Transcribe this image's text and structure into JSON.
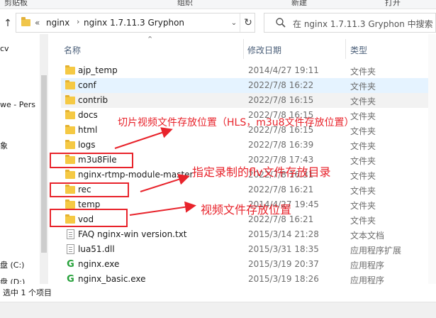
{
  "ribbon": {
    "labels": [
      "剪贴板",
      "组织",
      "新建",
      "打开"
    ]
  },
  "address": {
    "overflow": "«",
    "crumbs": [
      "nginx",
      "nginx 1.7.11.3 Gryphon"
    ]
  },
  "search": {
    "placeholder": "在 nginx 1.7.11.3 Gryphon 中搜索"
  },
  "nav_pane": {
    "items": [
      "cv",
      "we - Pers",
      "象",
      "盘 (C:)",
      "盘 (D:)"
    ]
  },
  "columns": {
    "name": "名称",
    "date": "修改日期",
    "type": "类型"
  },
  "files": [
    {
      "name": "ajp_temp",
      "date": "2014/4/27 19:11",
      "type": "文件夹",
      "icon": "folder-icon"
    },
    {
      "name": "conf",
      "date": "2022/7/8 16:22",
      "type": "文件夹",
      "icon": "folder-icon"
    },
    {
      "name": "contrib",
      "date": "2022/7/8 16:15",
      "type": "文件夹",
      "icon": "folder-icon"
    },
    {
      "name": "docs",
      "date": "2022/7/8 16:15",
      "type": "文件夹",
      "icon": "folder-icon"
    },
    {
      "name": "html",
      "date": "2022/7/8 16:15",
      "type": "文件夹",
      "icon": "folder-icon"
    },
    {
      "name": "logs",
      "date": "2022/7/8 16:39",
      "type": "文件夹",
      "icon": "folder-icon"
    },
    {
      "name": "m3u8File",
      "date": "2022/7/8 17:43",
      "type": "文件夹",
      "icon": "folder-icon"
    },
    {
      "name": "nginx-rtmp-module-master",
      "date": "2022/7/8 16:31",
      "type": "文件夹",
      "icon": "folder-icon"
    },
    {
      "name": "rec",
      "date": "2022/7/8 16:21",
      "type": "文件夹",
      "icon": "folder-icon"
    },
    {
      "name": "temp",
      "date": "2014/4/27 19:45",
      "type": "文件夹",
      "icon": "folder-icon"
    },
    {
      "name": "vod",
      "date": "2022/7/8 16:21",
      "type": "文件夹",
      "icon": "folder-icon"
    },
    {
      "name": "FAQ nginx-win version.txt",
      "date": "2015/3/14 21:28",
      "type": "文本文档",
      "icon": "text-file-icon"
    },
    {
      "name": "lua51.dll",
      "date": "2015/3/31 18:35",
      "type": "应用程序扩展",
      "icon": "dll-file-icon"
    },
    {
      "name": "nginx.exe",
      "date": "2015/3/19 20:37",
      "type": "应用程序",
      "icon": "nginx-exe-icon"
    },
    {
      "name": "nginx_basic.exe",
      "date": "2015/3/19 18:26",
      "type": "应用程序",
      "icon": "nginx-exe-icon"
    }
  ],
  "status": {
    "text": "选中 1 个项目"
  },
  "annotations": {
    "m3u8": "切片视频文件存放位置（HLS，m3u8文件存放位置）",
    "rec": "指定录制的flv文件存放目录",
    "vod": "视频文件存放位置",
    "color": "#e8232b"
  }
}
